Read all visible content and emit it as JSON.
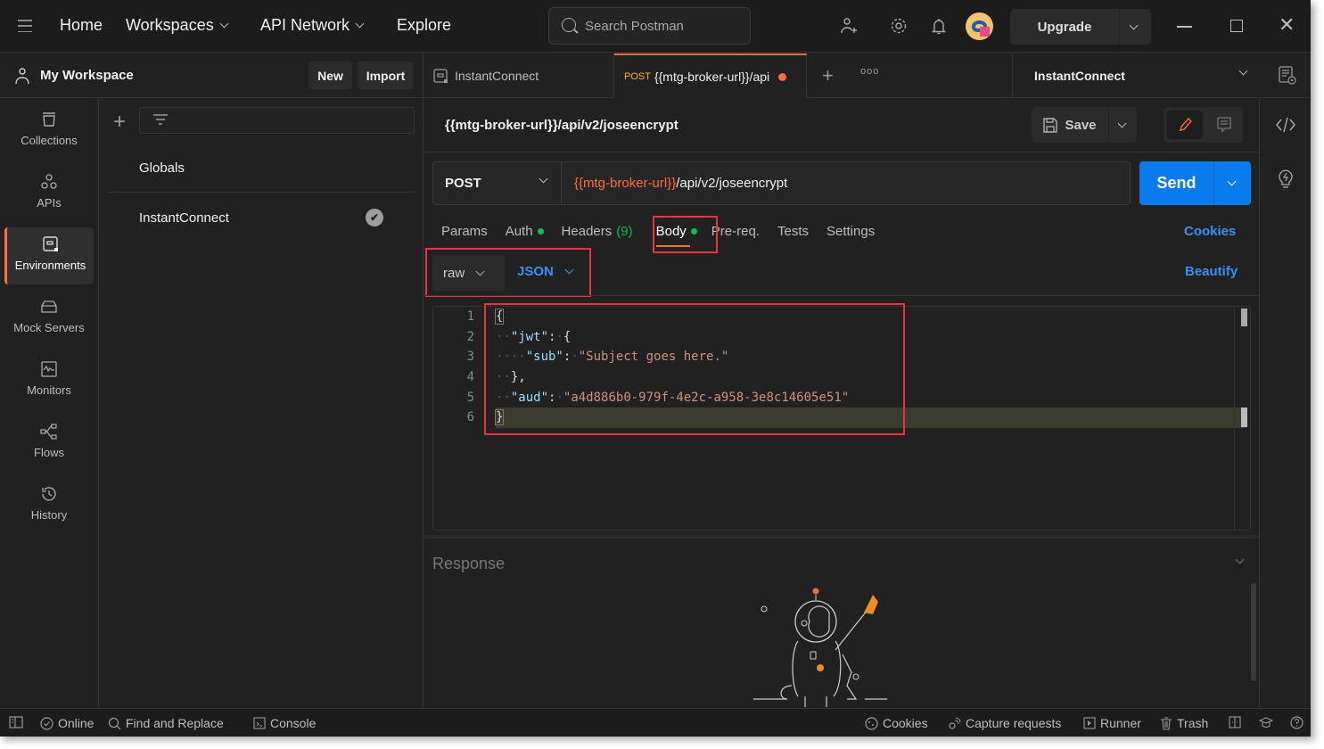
{
  "topbar": {
    "nav": [
      {
        "label": "Home",
        "has_menu": false
      },
      {
        "label": "Workspaces",
        "has_menu": true
      },
      {
        "label": "API Network",
        "has_menu": true
      },
      {
        "label": "Explore",
        "has_menu": false
      }
    ],
    "search_placeholder": "Search Postman",
    "upgrade_label": "Upgrade",
    "icons": [
      "invite-user-icon",
      "settings-icon",
      "bell-icon",
      "avatar"
    ]
  },
  "workspace": {
    "title": "My Workspace",
    "new_label": "New",
    "import_label": "Import"
  },
  "tabs": [
    {
      "label": "InstantConnect",
      "type": "environment",
      "active": false
    },
    {
      "method": "POST",
      "label": "{{mtg-broker-url}}/api",
      "active": true,
      "unsaved": true
    }
  ],
  "environment_selector": {
    "selected": "InstantConnect"
  },
  "left_nav": [
    {
      "label": "Collections",
      "icon": "collections-icon",
      "active": false
    },
    {
      "label": "APIs",
      "icon": "apis-icon",
      "active": false
    },
    {
      "label": "Environments",
      "icon": "environments-icon",
      "active": true
    },
    {
      "label": "Mock Servers",
      "icon": "mock-servers-icon",
      "active": false
    },
    {
      "label": "Monitors",
      "icon": "monitors-icon",
      "active": false
    },
    {
      "label": "Flows",
      "icon": "flows-icon",
      "active": false
    },
    {
      "label": "History",
      "icon": "history-icon",
      "active": false
    }
  ],
  "environments": {
    "filter_placeholder": "",
    "items": [
      {
        "label": "Globals",
        "active": false
      },
      {
        "label": "InstantConnect",
        "active": true
      }
    ]
  },
  "request": {
    "title": "{{mtg-broker-url}}/api/v2/joseencrypt",
    "save_label": "Save",
    "method": "POST",
    "url_variable": "{{mtg-broker-url}}",
    "url_path": "/api/v2/joseencrypt",
    "send_label": "Send",
    "tabs": [
      {
        "label": "Params",
        "dot": false,
        "count": ""
      },
      {
        "label": "Auth",
        "dot": true,
        "count": ""
      },
      {
        "label": "Headers",
        "dot": false,
        "count": "(9)"
      },
      {
        "label": "Body",
        "dot": true,
        "count": "",
        "active": true
      },
      {
        "label": "Pre-req.",
        "dot": false,
        "count": ""
      },
      {
        "label": "Tests",
        "dot": false,
        "count": ""
      },
      {
        "label": "Settings",
        "dot": false,
        "count": ""
      }
    ],
    "cookies_label": "Cookies",
    "body_mode": "raw",
    "body_language": "JSON",
    "beautify_label": "Beautify",
    "body_lines": [
      "1",
      "2",
      "3",
      "4",
      "5",
      "6"
    ],
    "body": {
      "jwt_key": "\"jwt\"",
      "sub_key": "\"sub\"",
      "sub_value": "\"Subject goes here.\"",
      "aud_key": "\"aud\"",
      "aud_value": "\"a4d886b0-979f-4e2c-a958-3e8c14605e51\""
    }
  },
  "response": {
    "title": "Response"
  },
  "statusbar": {
    "left": [
      {
        "label": "",
        "icon": "toggle-sidebar-icon"
      },
      {
        "label": "Online",
        "icon": "online-check-icon"
      },
      {
        "label": "Find and Replace",
        "icon": "search-icon"
      },
      {
        "label": "Console",
        "icon": "console-icon"
      }
    ],
    "right": [
      {
        "label": "Cookies",
        "icon": "cookie-icon"
      },
      {
        "label": "Capture requests",
        "icon": "capture-icon"
      },
      {
        "label": "Runner",
        "icon": "runner-icon"
      },
      {
        "label": "Trash",
        "icon": "trash-icon"
      }
    ]
  },
  "colors": {
    "accent": "#ff6c37",
    "send_blue": "#097bed",
    "link_blue": "#3a8ff3",
    "status_green": "#0cbb52",
    "highlight_red": "#e8343f"
  }
}
